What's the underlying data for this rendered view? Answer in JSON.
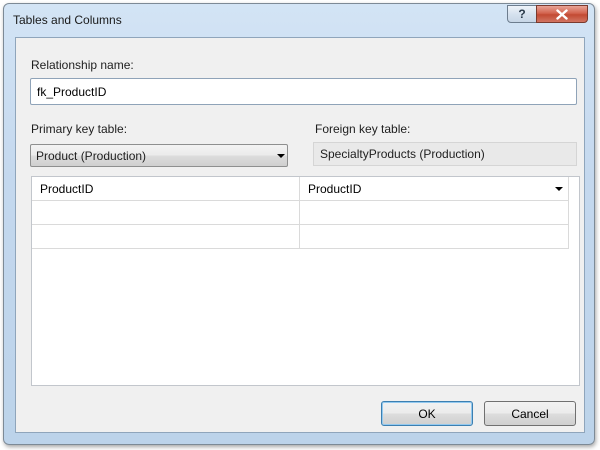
{
  "window": {
    "title": "Tables and Columns",
    "help_glyph": "?",
    "close_icon": "close-icon"
  },
  "relationship": {
    "label": "Relationship name:",
    "value": "fk_ProductID"
  },
  "primary_key": {
    "label": "Primary key table:",
    "selected": "Product (Production)"
  },
  "foreign_key": {
    "label": "Foreign key table:",
    "value": "SpecialtyProducts (Production)"
  },
  "columns_grid": {
    "rows": [
      {
        "primary": "ProductID",
        "foreign": "ProductID"
      },
      {
        "primary": "",
        "foreign": ""
      },
      {
        "primary": "",
        "foreign": ""
      }
    ]
  },
  "buttons": {
    "ok": "OK",
    "cancel": "Cancel"
  }
}
